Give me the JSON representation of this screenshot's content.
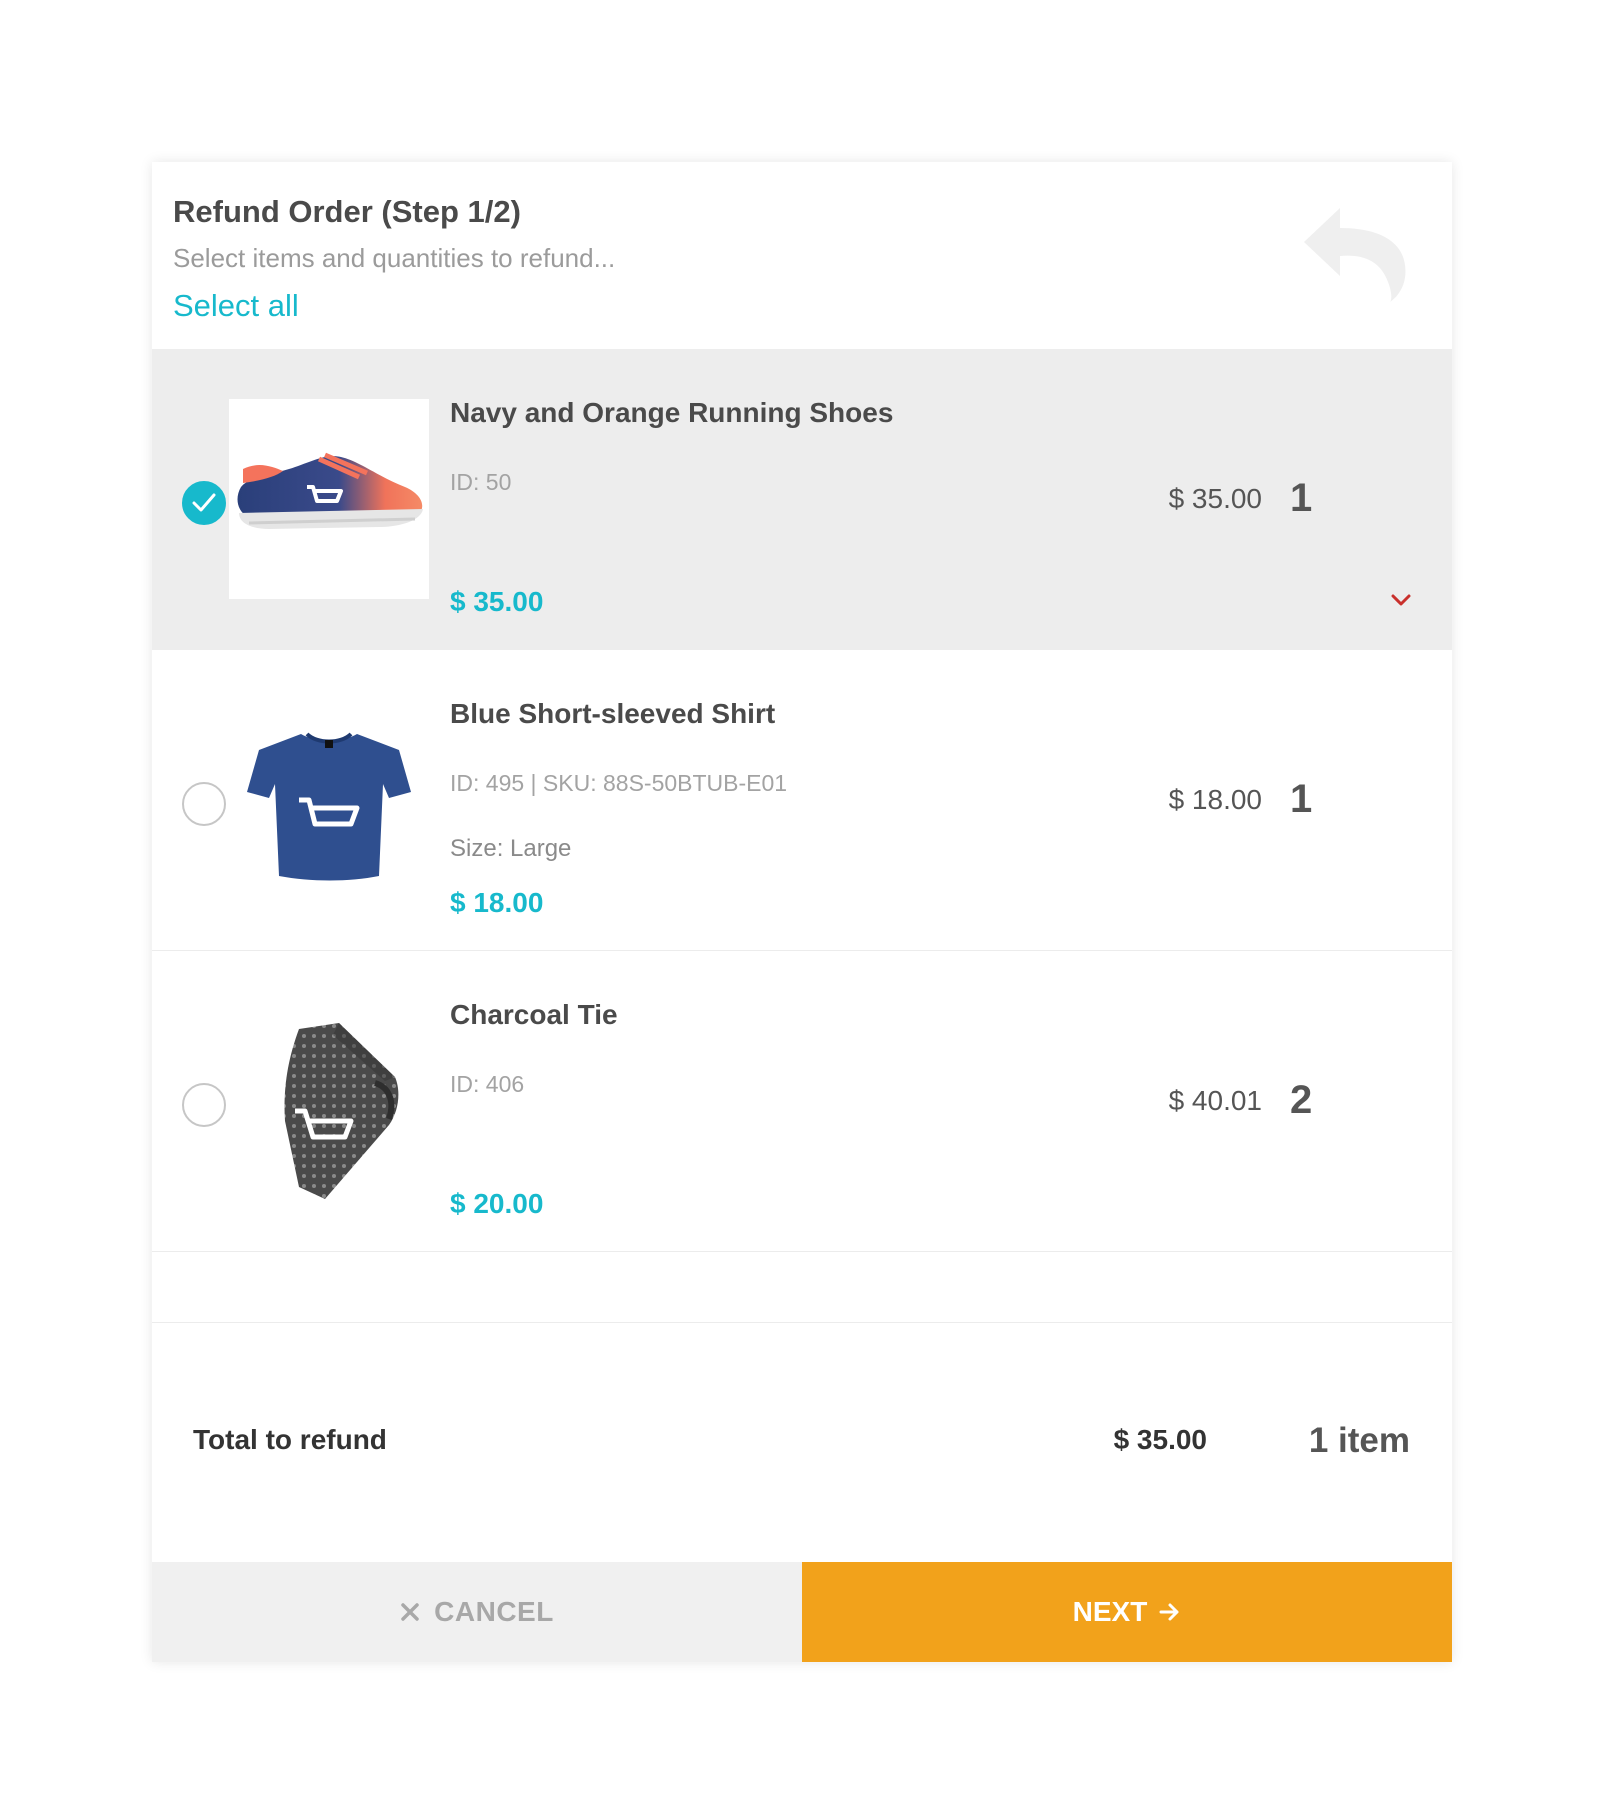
{
  "header": {
    "title": "Refund Order (Step 1/2)",
    "subtitle": "Select items and quantities to refund...",
    "select_all": "Select all",
    "back_icon": "undo-arrow-icon"
  },
  "items": [
    {
      "name": "Navy and Orange Running Shoes",
      "meta": "ID: 50",
      "size": "",
      "unit_price": "$ 35.00",
      "total_price": "$ 35.00",
      "quantity": "1",
      "selected": true,
      "image_icon": "running-shoe-image"
    },
    {
      "name": "Blue Short-sleeved Shirt",
      "meta": "ID: 495 | SKU: 88S-50BTUB-E01",
      "size": "Size: Large",
      "unit_price": "$ 18.00",
      "total_price": "$ 18.00",
      "quantity": "1",
      "selected": false,
      "image_icon": "tshirt-image"
    },
    {
      "name": "Charcoal Tie",
      "meta": "ID: 406",
      "size": "",
      "unit_price": "$ 20.00",
      "total_price": "$ 40.01",
      "quantity": "2",
      "selected": false,
      "image_icon": "tie-image"
    }
  ],
  "summary": {
    "label": "Total to refund",
    "amount": "$ 35.00",
    "count": "1 item"
  },
  "footer": {
    "cancel_label": "CANCEL",
    "next_label": "NEXT"
  },
  "colors": {
    "accent": "#17b9cc",
    "primary_button": "#f2a21b",
    "selected_row": "#ededed",
    "chevron": "#c9302c"
  }
}
